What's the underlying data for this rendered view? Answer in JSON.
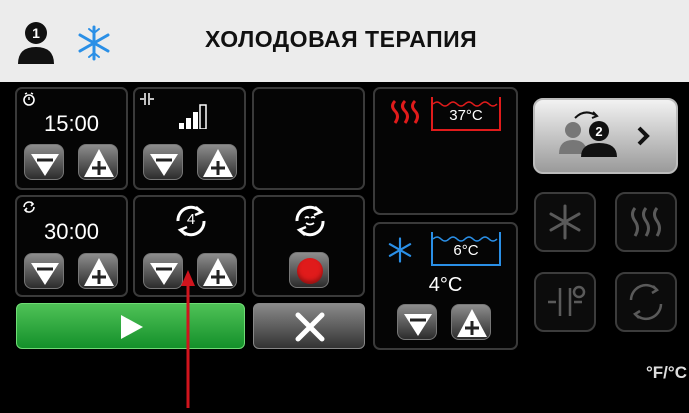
{
  "header": {
    "title": "ХОЛОДОВАЯ ТЕРАПИЯ",
    "user_icon": "user-1-icon",
    "mode_icon": "snowflake-icon"
  },
  "timers": {
    "timer1_value": "15:00",
    "timer2_value": "30:00",
    "cycle_count": "4",
    "signal_icon": "signal-bars-icon"
  },
  "heat_panel": {
    "temp": "37°C",
    "icon": "heat-waves-icon"
  },
  "cold_panel": {
    "temp": "6°C",
    "setpoint": "4°C",
    "icon": "snowflake-icon"
  },
  "side": {
    "switch_user_number": "2",
    "unit_label": "°F/°C"
  },
  "colors": {
    "header_bg": "#ececec",
    "green": "#2fb64a",
    "red": "#e01b1b",
    "blue_accent": "#2a8fe6",
    "arrow": "#d0141d"
  }
}
